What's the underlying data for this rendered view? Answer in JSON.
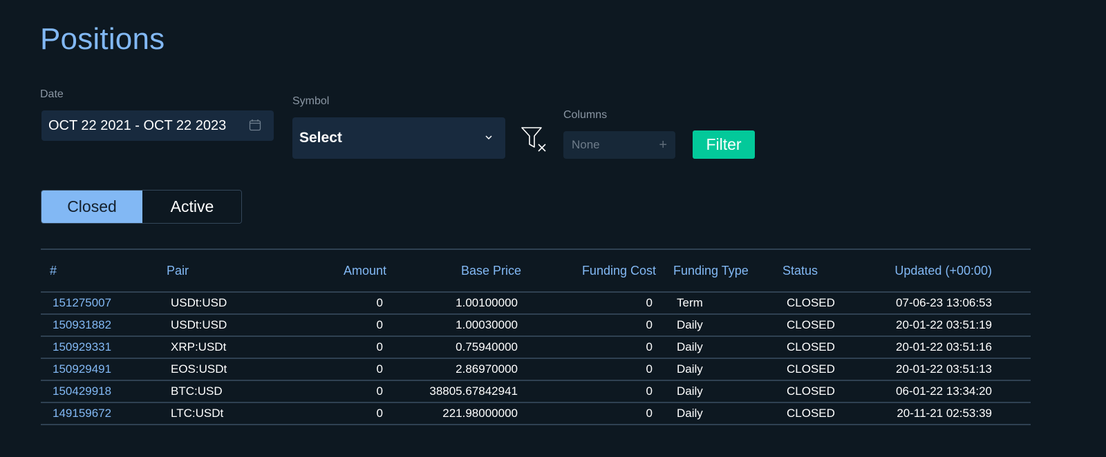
{
  "page": {
    "title": "Positions"
  },
  "filters": {
    "date": {
      "label": "Date",
      "value": "OCT 22 2021 - OCT 22 2023",
      "icon": "calendar-icon"
    },
    "symbol": {
      "label": "Symbol",
      "value": "Select",
      "icon": "chevron-down-icon"
    },
    "clear_filter_icon": "filter-clear-icon",
    "columns": {
      "label": "Columns",
      "value": "None",
      "icon": "plus-icon",
      "icon_glyph": "+"
    },
    "filter_button": "Filter"
  },
  "tabs": [
    {
      "label": "Closed",
      "selected": true
    },
    {
      "label": "Active",
      "selected": false
    }
  ],
  "table": {
    "columns": [
      "#",
      "Pair",
      "Amount",
      "Base Price",
      "Funding Cost",
      "Funding Type",
      "Status",
      "Updated (+00:00)"
    ],
    "rows": [
      {
        "id": "151275007",
        "pair": "USDt:USD",
        "amount": "0",
        "base_price": "1.00100000",
        "funding_cost": "0",
        "funding_type": "Term",
        "status": "CLOSED",
        "updated": "07-06-23 13:06:53"
      },
      {
        "id": "150931882",
        "pair": "USDt:USD",
        "amount": "0",
        "base_price": "1.00030000",
        "funding_cost": "0",
        "funding_type": "Daily",
        "status": "CLOSED",
        "updated": "20-01-22 03:51:19"
      },
      {
        "id": "150929331",
        "pair": "XRP:USDt",
        "amount": "0",
        "base_price": "0.75940000",
        "funding_cost": "0",
        "funding_type": "Daily",
        "status": "CLOSED",
        "updated": "20-01-22 03:51:16"
      },
      {
        "id": "150929491",
        "pair": "EOS:USDt",
        "amount": "0",
        "base_price": "2.86970000",
        "funding_cost": "0",
        "funding_type": "Daily",
        "status": "CLOSED",
        "updated": "20-01-22 03:51:13"
      },
      {
        "id": "150429918",
        "pair": "BTC:USD",
        "amount": "0",
        "base_price": "38805.67842941",
        "funding_cost": "0",
        "funding_type": "Daily",
        "status": "CLOSED",
        "updated": "06-01-22 13:34:20"
      },
      {
        "id": "149159672",
        "pair": "LTC:USDt",
        "amount": "0",
        "base_price": "221.98000000",
        "funding_cost": "0",
        "funding_type": "Daily",
        "status": "CLOSED",
        "updated": "20-11-21 02:53:39"
      }
    ]
  },
  "colors": {
    "background": "#0d1821",
    "accent": "#82b8f4",
    "input_bg": "#182a3e",
    "filter_button": "#03c99a",
    "divider": "#2f4152"
  }
}
